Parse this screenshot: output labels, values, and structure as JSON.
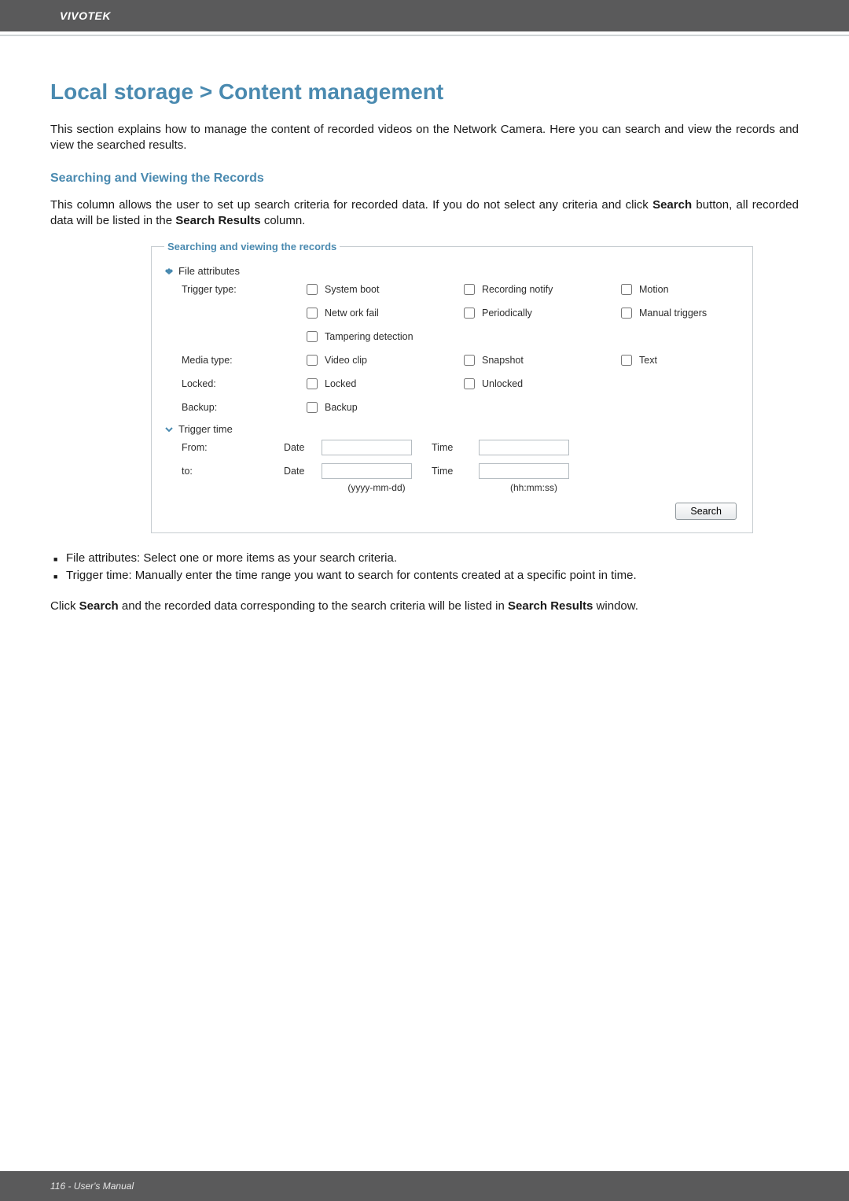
{
  "header": {
    "brand": "VIVOTEK"
  },
  "title": "Local storage > Content management",
  "intro": "This section explains how to manage the content of recorded videos on the Network Camera. Here you can search and view the records and view the searched results.",
  "section_heading": "Searching and Viewing the Records",
  "section_intro_pre": "This column allows the user to set up search criteria for recorded data. If you do not select any criteria and click ",
  "section_intro_bold1": "Search",
  "section_intro_mid": " button, all recorded data will be listed in the ",
  "section_intro_bold2": "Search Results",
  "section_intro_post": " column.",
  "form": {
    "legend": "Searching and viewing the records",
    "file_attributes_label": "File attributes",
    "trigger_type_label": "Trigger type:",
    "system_boot": "System boot",
    "recording_notify": "Recording notify",
    "motion": "Motion",
    "network_fail": "Netw ork fail",
    "periodically": "Periodically",
    "manual_triggers": "Manual triggers",
    "tampering_detection": "Tampering detection",
    "media_type_label": "Media type:",
    "video_clip": "Video clip",
    "snapshot": "Snapshot",
    "text": "Text",
    "locked_label": "Locked:",
    "locked": "Locked",
    "unlocked": "Unlocked",
    "backup_label": "Backup:",
    "backup": "Backup",
    "trigger_time_label": "Trigger time",
    "from_label": "From:",
    "to_label": "to:",
    "date_label": "Date",
    "time_label": "Time",
    "date_hint": "(yyyy-mm-dd)",
    "time_hint": "(hh:mm:ss)",
    "search_button": "Search"
  },
  "bullets": {
    "b1": "File attributes: Select one or more items as your search criteria.",
    "b2": "Trigger time: Manually enter the time range you want to search for contents created at a specific point in time."
  },
  "closing_pre": "Click ",
  "closing_bold1": "Search",
  "closing_mid": " and the recorded data corresponding to the search criteria will be listed in ",
  "closing_bold2": "Search Results",
  "closing_post": " window.",
  "footer": "116 - User's Manual"
}
